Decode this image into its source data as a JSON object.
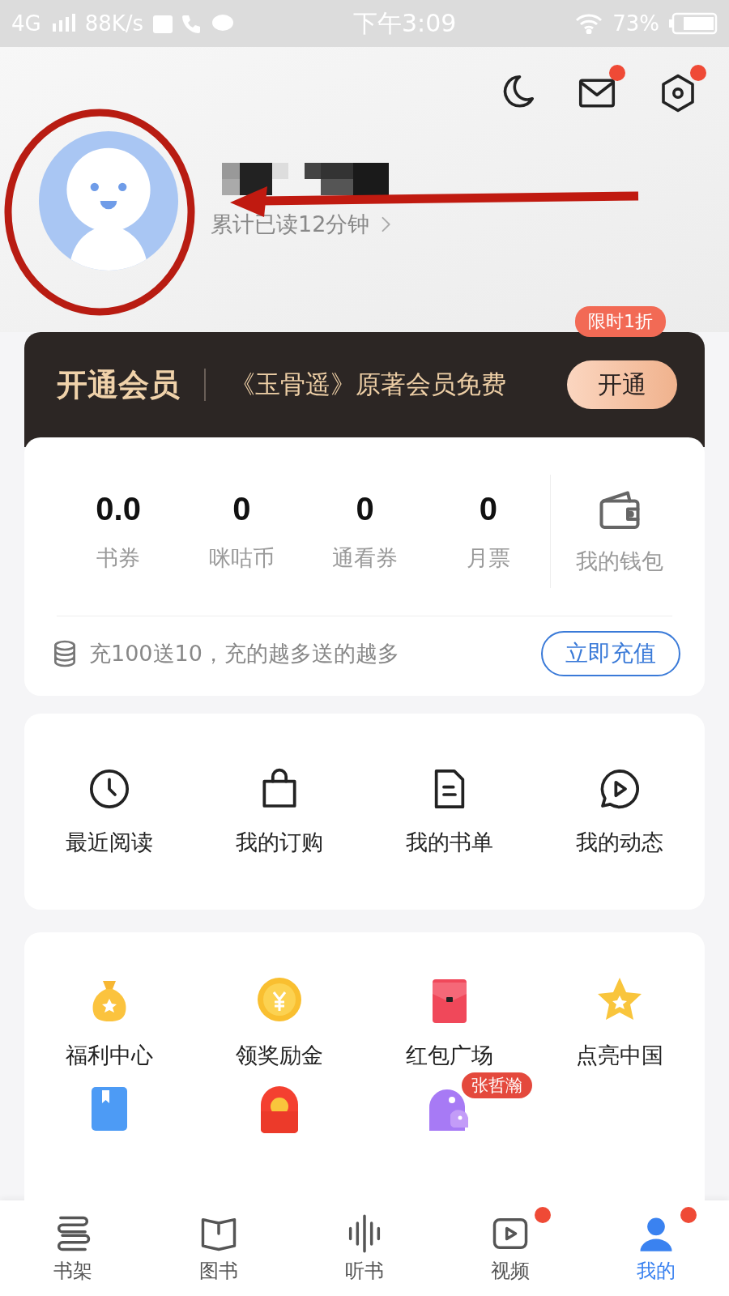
{
  "status_bar": {
    "network": "4G",
    "speed": "88K/s",
    "time": "下午3:09",
    "battery": "73%"
  },
  "header_icons": [
    {
      "kind": "moon",
      "dot": false
    },
    {
      "kind": "mail",
      "dot": true
    },
    {
      "kind": "settings",
      "dot": true
    }
  ],
  "profile": {
    "reading_time": "累计已读12分钟"
  },
  "membership": {
    "title": "开通会员",
    "promo": "《玉骨遥》原著会员免费",
    "button": "开通",
    "tag": "限时1折"
  },
  "wallet": {
    "stats": [
      {
        "value": "0.0",
        "label": "书券"
      },
      {
        "value": "0",
        "label": "咪咕币"
      },
      {
        "value": "0",
        "label": "通看券"
      },
      {
        "value": "0",
        "label": "月票"
      }
    ],
    "wallet_link": "我的钱包",
    "recharge_text": "充100送10，充的越多送的越多",
    "recharge_button": "立即充值"
  },
  "shortcuts": [
    {
      "kind": "clock",
      "label": "最近阅读"
    },
    {
      "kind": "bag",
      "label": "我的订购"
    },
    {
      "kind": "doc",
      "label": "我的书单"
    },
    {
      "kind": "chat",
      "label": "我的动态"
    }
  ],
  "features": [
    {
      "kind": "moneybag",
      "label": "福利中心"
    },
    {
      "kind": "coin",
      "label": "领奖励金"
    },
    {
      "kind": "redpacket",
      "label": "红包广场"
    },
    {
      "kind": "star",
      "label": "点亮中国"
    },
    {
      "kind": "book"
    },
    {
      "kind": "signin"
    },
    {
      "kind": "bird",
      "badge": "张哲瀚"
    }
  ],
  "tabs": [
    {
      "kind": "shelf",
      "label": "书架",
      "selected": false,
      "dot": false
    },
    {
      "kind": "book",
      "label": "图书",
      "selected": false,
      "dot": false
    },
    {
      "kind": "audio",
      "label": "听书",
      "selected": false,
      "dot": false
    },
    {
      "kind": "video",
      "label": "视频",
      "selected": false,
      "dot": true
    },
    {
      "kind": "person",
      "label": "我的",
      "selected": true,
      "dot": true
    }
  ]
}
